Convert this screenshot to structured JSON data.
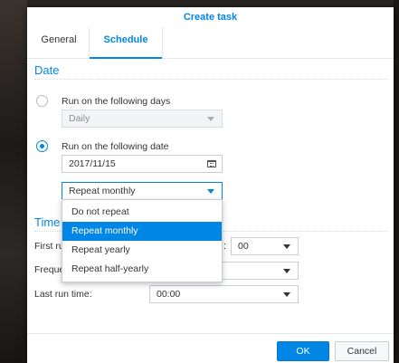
{
  "dialog": {
    "title": "Create task",
    "tabs": [
      "General",
      "Schedule"
    ],
    "active_tab": "Schedule"
  },
  "date_section": {
    "heading": "Date",
    "option_days_label": "Run on the following days",
    "days_value": "Daily",
    "option_date_label": "Run on the following date",
    "selected_option": "date",
    "date_value": "2017/11/15",
    "repeat_value": "Repeat monthly"
  },
  "repeat_dropdown": {
    "open": true,
    "options": [
      "Do not repeat",
      "Repeat monthly",
      "Repeat yearly",
      "Repeat half-yearly"
    ],
    "selected_index": 1
  },
  "time_section": {
    "heading": "Time",
    "first_run_label": "First run time:",
    "first_run_colon": ":",
    "first_run_minute": "00",
    "frequency_label": "Frequency:",
    "frequency_value": "",
    "last_run_label": "Last run time:",
    "last_run_value": "00:00"
  },
  "footer": {
    "ok_label": "OK",
    "cancel_label": "Cancel"
  },
  "colors": {
    "accent": "#0086e5",
    "dialog_bg": "#ffffff",
    "border": "#c7cdd3"
  }
}
